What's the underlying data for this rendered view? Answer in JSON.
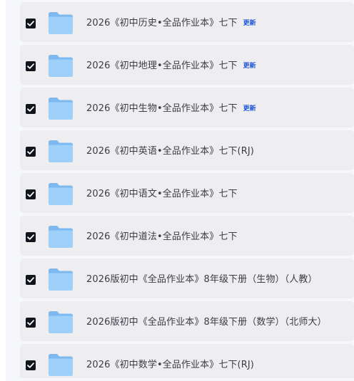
{
  "file_list": {
    "items": [
      {
        "name": "2026《初中历史•全品作业本》七下",
        "badge": "更新",
        "checked": true
      },
      {
        "name": "2026《初中地理•全品作业本》七下",
        "badge": "更新",
        "checked": true
      },
      {
        "name": "2026《初中生物•全品作业本》七下",
        "badge": "更新",
        "checked": true
      },
      {
        "name": "2026《初中英语•全品作业本》七下(RJ)",
        "badge": "",
        "checked": true
      },
      {
        "name": "2026《初中语文•全品作业本》七下",
        "badge": "",
        "checked": true
      },
      {
        "name": "2026《初中道法•全品作业本》七下",
        "badge": "",
        "checked": true
      },
      {
        "name": "2026版初中《全品作业本》8年级下册（生物）（人教）",
        "badge": "",
        "checked": true
      },
      {
        "name": "2026版初中《全品作业本》8年级下册（数学）（北师大）",
        "badge": "",
        "checked": true
      },
      {
        "name": "2026《初中数学•全品作业本》七下(RJ)",
        "badge": "",
        "checked": true
      }
    ]
  },
  "colors": {
    "row_background": "#eeeef1",
    "checkbox": "#13151d",
    "folder_back": "#7db8ef",
    "folder_front": "#9fd0f9",
    "badge": "#1f55d6",
    "text": "#3b3d46"
  },
  "icons": {
    "checkbox": "checkmark-icon",
    "file": "folder-icon"
  }
}
